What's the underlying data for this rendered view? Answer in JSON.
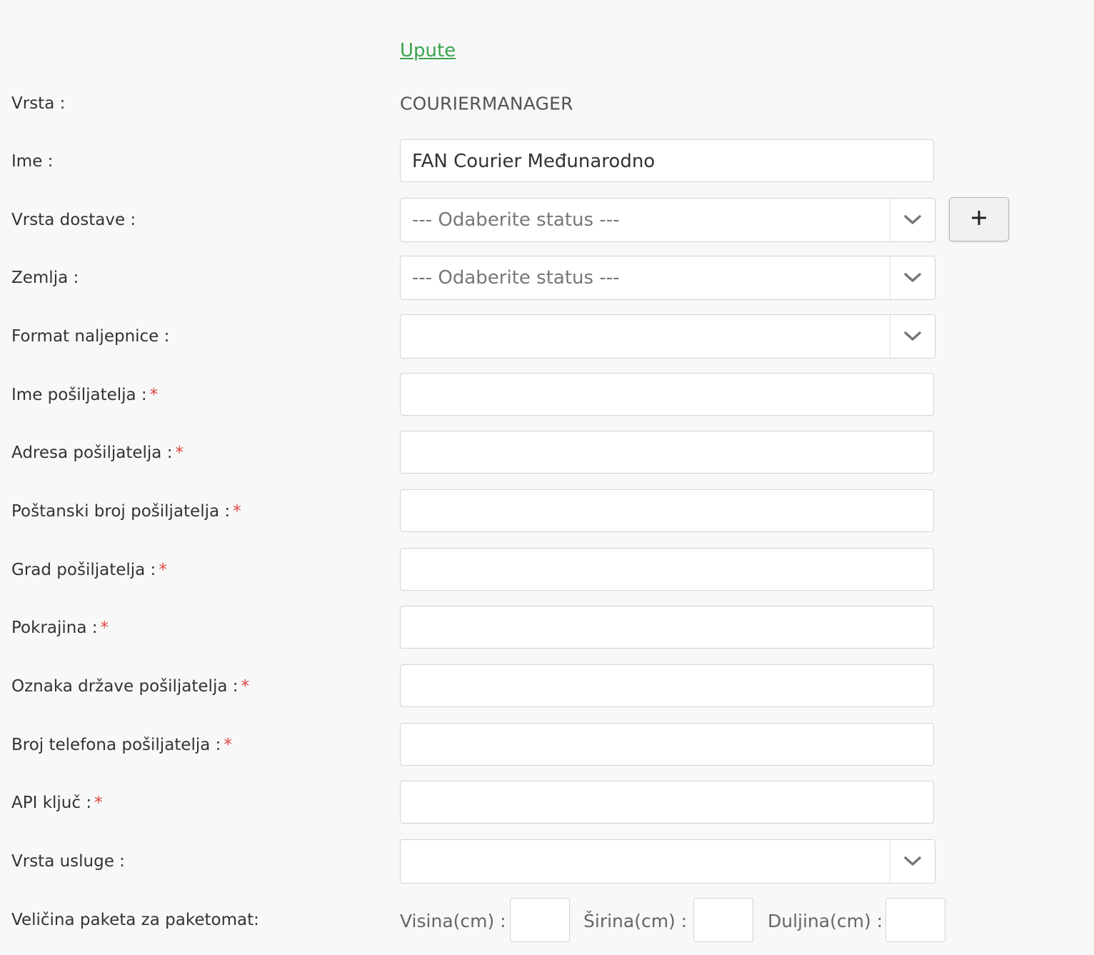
{
  "help": {
    "link_label": "Upute"
  },
  "fields": {
    "vrsta": {
      "label": "Vrsta :",
      "value": "COURIERMANAGER"
    },
    "ime": {
      "label": "Ime :",
      "value": "FAN Courier Međunarodno"
    },
    "vrsta_dostave": {
      "label": "Vrsta dostave :",
      "selected": "--- Odaberite status ---",
      "add_button_label": "+"
    },
    "zemlja": {
      "label": "Zemlja :",
      "selected": "--- Odaberite status ---"
    },
    "format_naljepnice": {
      "label": "Format naljepnice :",
      "selected": ""
    },
    "ime_posiljatelja": {
      "label": "Ime pošiljatelja :",
      "required_mark": "*",
      "value": ""
    },
    "adresa_posiljatelja": {
      "label": "Adresa pošiljatelja :",
      "required_mark": "*",
      "value": ""
    },
    "postanski_broj": {
      "label": "Poštanski broj pošiljatelja :",
      "required_mark": "*",
      "value": ""
    },
    "grad_posiljatelja": {
      "label": "Grad pošiljatelja :",
      "required_mark": "*",
      "value": ""
    },
    "pokrajina": {
      "label": "Pokrajina :",
      "required_mark": "*",
      "value": ""
    },
    "oznaka_drzave": {
      "label": "Oznaka države pošiljatelja :",
      "required_mark": "*",
      "value": ""
    },
    "broj_telefona": {
      "label": "Broj telefona pošiljatelja :",
      "required_mark": "*",
      "value": ""
    },
    "api_kljuc": {
      "label": "API ključ :",
      "required_mark": "*",
      "value": ""
    },
    "vrsta_usluge": {
      "label": "Vrsta usluge :",
      "selected": ""
    },
    "velicina_paketa": {
      "label": "Veličina paketa za paketomat:",
      "visina_label": "Visina(cm) :",
      "sirina_label": "Širina(cm) :",
      "duljina_label": "Duljina(cm) :",
      "visina_value": "",
      "sirina_value": "",
      "duljina_value": ""
    }
  },
  "icons": {
    "dropdown": "chevron-down-icon",
    "add": "plus-icon"
  },
  "colors": {
    "link": "#3aa44f",
    "required": "#e0463f",
    "background": "#f8f8f8"
  }
}
